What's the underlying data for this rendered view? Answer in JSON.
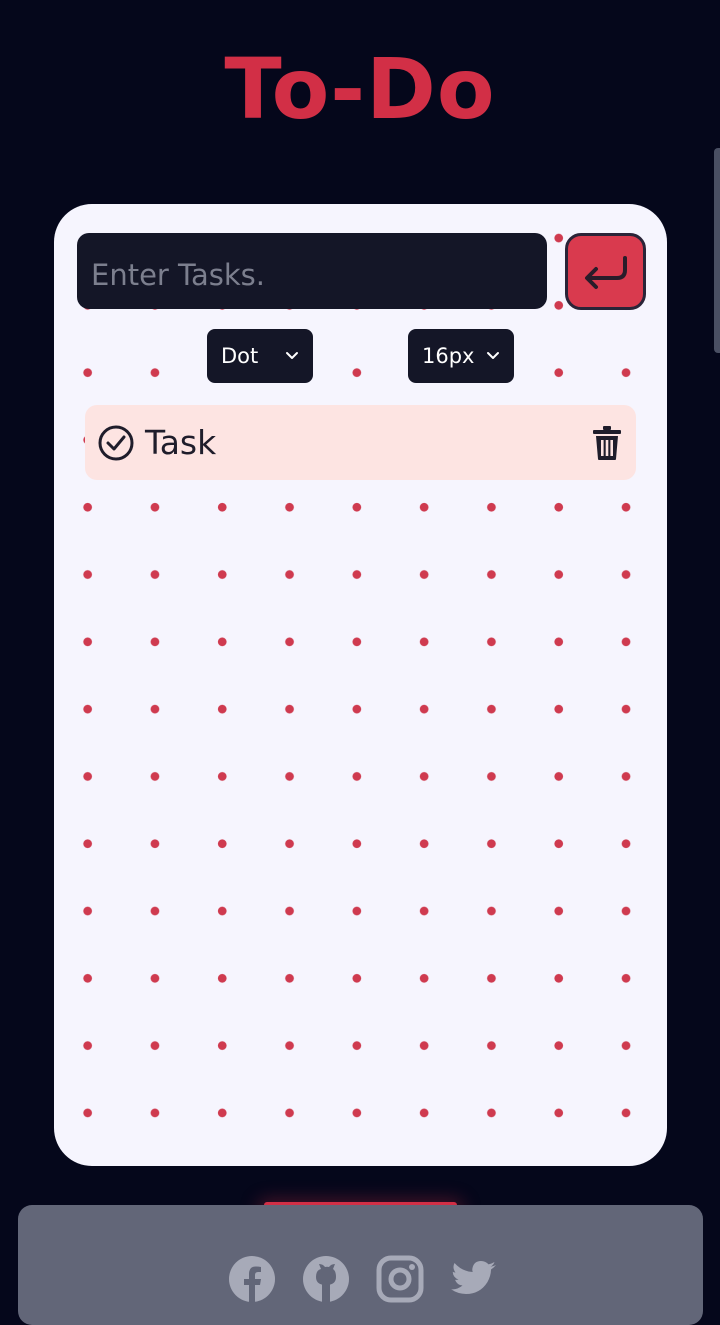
{
  "app": {
    "title": "To-Do"
  },
  "input": {
    "placeholder": "Enter Tasks.",
    "value": ""
  },
  "controls": {
    "style_select": {
      "selected": "Dot"
    },
    "size_select": {
      "selected": "16px"
    }
  },
  "tasks": [
    {
      "text": "Task",
      "completed": false
    }
  ],
  "footer": {
    "socials": [
      "facebook-icon",
      "github-icon",
      "instagram-icon",
      "twitter-icon"
    ]
  },
  "colors": {
    "background": "#05071b",
    "accent": "#d22f46",
    "card": "#f6f5fe",
    "task_bg": "#fde4e2",
    "input_bg": "#141627",
    "footer_bg": "#626678"
  }
}
